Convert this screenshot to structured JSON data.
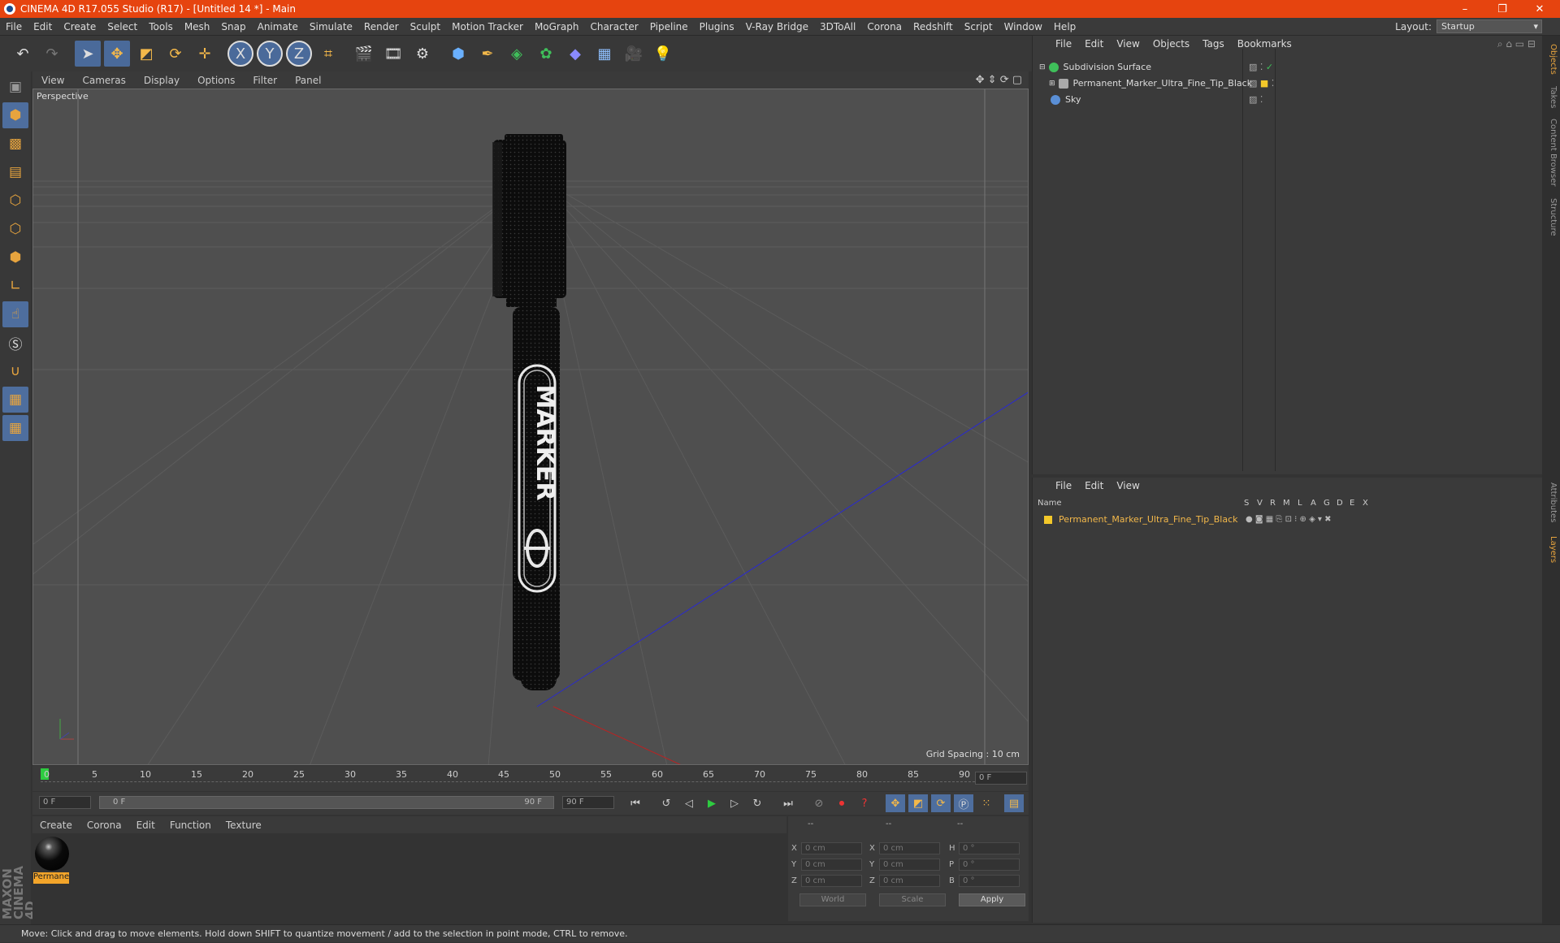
{
  "title": "CINEMA 4D R17.055 Studio (R17) - [Untitled 14 *] - Main",
  "window_controls": [
    "–",
    "❐",
    "✕"
  ],
  "menu": [
    "File",
    "Edit",
    "Create",
    "Select",
    "Tools",
    "Mesh",
    "Snap",
    "Animate",
    "Simulate",
    "Render",
    "Sculpt",
    "Motion Tracker",
    "MoGraph",
    "Character",
    "Pipeline",
    "Plugins",
    "V-Ray Bridge",
    "3DToAll",
    "Corona",
    "Redshift",
    "Script",
    "Window",
    "Help"
  ],
  "layout": {
    "label": "Layout:",
    "value": "Startup"
  },
  "toolbar_icons": [
    "undo-icon",
    "redo-icon",
    "select-arrow-icon",
    "move-icon",
    "scale-icon",
    "rotate-icon",
    "move-plus-icon",
    "x-axis-icon",
    "y-axis-icon",
    "z-axis-icon",
    "coordinate-system-icon",
    "render-view-icon",
    "render-picture-icon",
    "render-settings-icon",
    "cube-icon",
    "pen-icon",
    "subdivision-icon",
    "array-icon",
    "deformer-icon",
    "floor-icon",
    "camera-icon",
    "light-icon"
  ],
  "axis_labels": [
    "X",
    "Y",
    "Z"
  ],
  "viewport": {
    "menu": [
      "View",
      "Cameras",
      "Display",
      "Options",
      "Filter",
      "Panel"
    ],
    "label": "Perspective",
    "grid_spacing": "Grid Spacing : 10 cm",
    "marker_text": "MARKER"
  },
  "timeline": {
    "ticks": [
      "0",
      "5",
      "10",
      "15",
      "20",
      "25",
      "30",
      "35",
      "40",
      "45",
      "50",
      "55",
      "60",
      "65",
      "70",
      "75",
      "80",
      "85",
      "90"
    ],
    "current_frame": "0 F",
    "start": "0 F",
    "range_start": "0 F",
    "range_end": "90 F",
    "end": "90 F"
  },
  "material_manager": {
    "menu": [
      "Create",
      "Corona",
      "Edit",
      "Function",
      "Texture"
    ],
    "material_name": "Permanent"
  },
  "coordinates": {
    "headers": [
      "--",
      "--",
      "--"
    ],
    "rows": [
      {
        "a": "X",
        "av": "0 cm",
        "b": "X",
        "bv": "0 cm",
        "c": "H",
        "cv": "0 °"
      },
      {
        "a": "Y",
        "av": "0 cm",
        "b": "Y",
        "bv": "0 cm",
        "c": "P",
        "cv": "0 °"
      },
      {
        "a": "Z",
        "av": "0 cm",
        "b": "Z",
        "bv": "0 cm",
        "c": "B",
        "cv": "0 °"
      }
    ],
    "world": "World",
    "scale": "Scale",
    "apply": "Apply"
  },
  "object_manager": {
    "menu": [
      "File",
      "Edit",
      "View",
      "Objects",
      "Tags",
      "Bookmarks"
    ],
    "objects": [
      {
        "name": "Subdivision Surface",
        "color": "#3fbf5a"
      },
      {
        "name": "Permanent_Marker_Ultra_Fine_Tip_Black",
        "color": "#aaaaaa"
      },
      {
        "name": "Sky",
        "color": "#5a8fd6"
      }
    ]
  },
  "layer_manager": {
    "menu": [
      "File",
      "Edit",
      "View"
    ],
    "columns": [
      "Name",
      "S",
      "V",
      "R",
      "M",
      "L",
      "A",
      "G",
      "D",
      "E",
      "X"
    ],
    "layer": "Permanent_Marker_Ultra_Fine_Tip_Black",
    "layer_color": "#f3c82a"
  },
  "side_tabs": [
    "Objects",
    "Takes",
    "Content Browser",
    "Structure",
    "Attributes",
    "Layers"
  ],
  "status": "Move: Click and drag to move elements. Hold down SHIFT to quantize movement / add to the selection in point mode, CTRL to remove.",
  "brand": "MAXON CINEMA 4D"
}
